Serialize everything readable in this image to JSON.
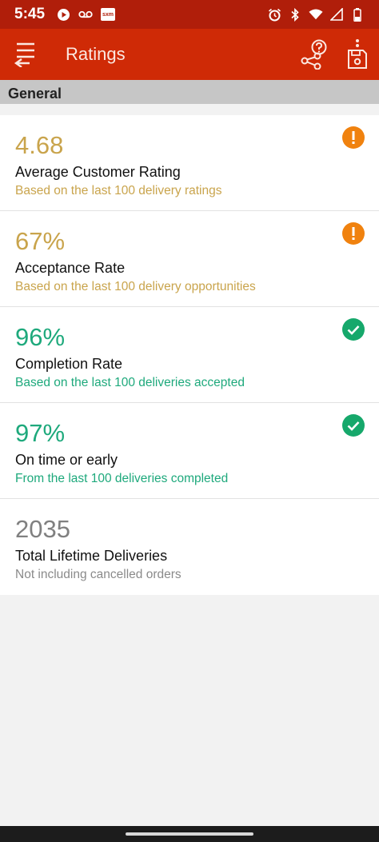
{
  "status_bar": {
    "time": "5:45",
    "sxm_label": "sxm"
  },
  "app_bar": {
    "title": "Ratings"
  },
  "section": {
    "title": "General"
  },
  "colors": {
    "warning": "#c9a44c",
    "success": "#1ea97c",
    "neutral": "#808080",
    "warning_badge": "#f0820f",
    "success_badge": "#16a86b"
  },
  "ratings": [
    {
      "value": "4.68",
      "title": "Average Customer Rating",
      "subtitle": "Based on the last 100 delivery ratings",
      "status": "warning"
    },
    {
      "value": "67%",
      "title": "Acceptance Rate",
      "subtitle": "Based on the last 100 delivery opportunities",
      "status": "warning"
    },
    {
      "value": "96%",
      "title": "Completion Rate",
      "subtitle": "Based on the last 100 deliveries accepted",
      "status": "success"
    },
    {
      "value": "97%",
      "title": "On time or early",
      "subtitle": "From the last 100 deliveries completed",
      "status": "success"
    },
    {
      "value": "2035",
      "title": "Total Lifetime Deliveries",
      "subtitle": "Not including cancelled orders",
      "status": "neutral"
    }
  ]
}
